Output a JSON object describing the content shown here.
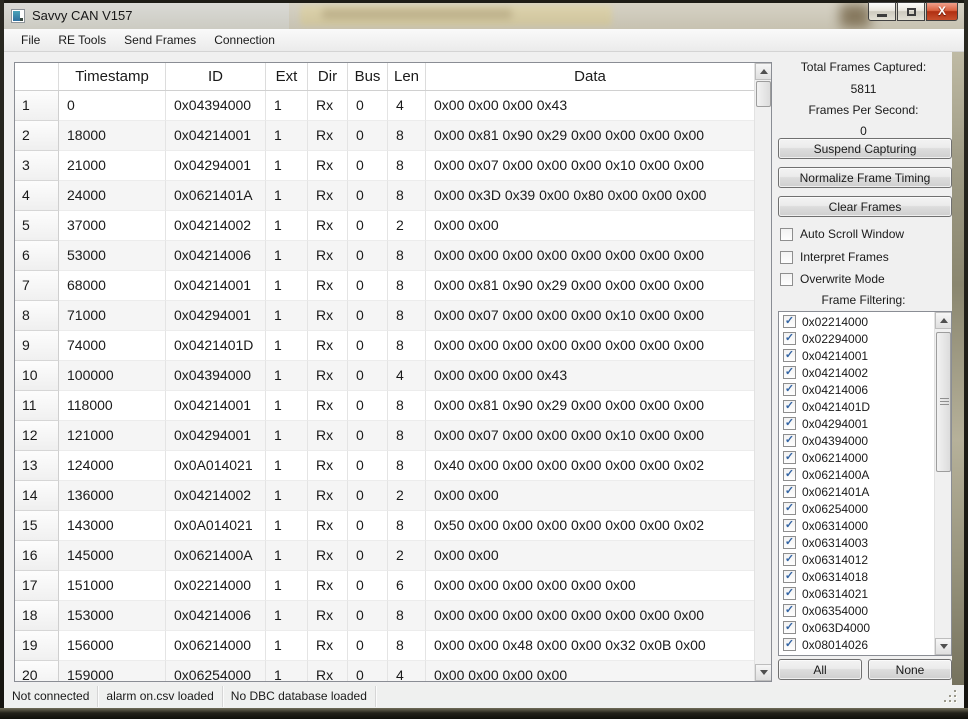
{
  "window": {
    "title": "Savvy CAN V157"
  },
  "menu": {
    "items": [
      "File",
      "RE Tools",
      "Send Frames",
      "Connection"
    ]
  },
  "table": {
    "headers": [
      "Timestamp",
      "ID",
      "Ext",
      "Dir",
      "Bus",
      "Len",
      "Data"
    ],
    "rows": [
      [
        "1",
        "0",
        "0x04394000",
        "1",
        "Rx",
        "0",
        "4",
        "0x00 0x00 0x00 0x43"
      ],
      [
        "2",
        "18000",
        "0x04214001",
        "1",
        "Rx",
        "0",
        "8",
        "0x00 0x81 0x90 0x29 0x00 0x00 0x00 0x00"
      ],
      [
        "3",
        "21000",
        "0x04294001",
        "1",
        "Rx",
        "0",
        "8",
        "0x00 0x07 0x00 0x00 0x00 0x10 0x00 0x00"
      ],
      [
        "4",
        "24000",
        "0x0621401A",
        "1",
        "Rx",
        "0",
        "8",
        "0x00 0x3D 0x39 0x00 0x80 0x00 0x00 0x00"
      ],
      [
        "5",
        "37000",
        "0x04214002",
        "1",
        "Rx",
        "0",
        "2",
        "0x00 0x00"
      ],
      [
        "6",
        "53000",
        "0x04214006",
        "1",
        "Rx",
        "0",
        "8",
        "0x00 0x00 0x00 0x00 0x00 0x00 0x00 0x00"
      ],
      [
        "7",
        "68000",
        "0x04214001",
        "1",
        "Rx",
        "0",
        "8",
        "0x00 0x81 0x90 0x29 0x00 0x00 0x00 0x00"
      ],
      [
        "8",
        "71000",
        "0x04294001",
        "1",
        "Rx",
        "0",
        "8",
        "0x00 0x07 0x00 0x00 0x00 0x10 0x00 0x00"
      ],
      [
        "9",
        "74000",
        "0x0421401D",
        "1",
        "Rx",
        "0",
        "8",
        "0x00 0x00 0x00 0x00 0x00 0x00 0x00 0x00"
      ],
      [
        "10",
        "100000",
        "0x04394000",
        "1",
        "Rx",
        "0",
        "4",
        "0x00 0x00 0x00 0x43"
      ],
      [
        "11",
        "118000",
        "0x04214001",
        "1",
        "Rx",
        "0",
        "8",
        "0x00 0x81 0x90 0x29 0x00 0x00 0x00 0x00"
      ],
      [
        "12",
        "121000",
        "0x04294001",
        "1",
        "Rx",
        "0",
        "8",
        "0x00 0x07 0x00 0x00 0x00 0x10 0x00 0x00"
      ],
      [
        "13",
        "124000",
        "0x0A014021",
        "1",
        "Rx",
        "0",
        "8",
        "0x40 0x00 0x00 0x00 0x00 0x00 0x00 0x02"
      ],
      [
        "14",
        "136000",
        "0x04214002",
        "1",
        "Rx",
        "0",
        "2",
        "0x00 0x00"
      ],
      [
        "15",
        "143000",
        "0x0A014021",
        "1",
        "Rx",
        "0",
        "8",
        "0x50 0x00 0x00 0x00 0x00 0x00 0x00 0x02"
      ],
      [
        "16",
        "145000",
        "0x0621400A",
        "1",
        "Rx",
        "0",
        "2",
        "0x00 0x00"
      ],
      [
        "17",
        "151000",
        "0x02214000",
        "1",
        "Rx",
        "0",
        "6",
        "0x00 0x00 0x00 0x00 0x00 0x00"
      ],
      [
        "18",
        "153000",
        "0x04214006",
        "1",
        "Rx",
        "0",
        "8",
        "0x00 0x00 0x00 0x00 0x00 0x00 0x00 0x00"
      ],
      [
        "19",
        "156000",
        "0x06214000",
        "1",
        "Rx",
        "0",
        "8",
        "0x00 0x00 0x48 0x00 0x00 0x32 0x0B 0x00"
      ],
      [
        "20",
        "159000",
        "0x06254000",
        "1",
        "Rx",
        "0",
        "4",
        "0x00 0x00 0x00 0x00"
      ]
    ]
  },
  "sidebar": {
    "total_frames_label": "Total Frames Captured:",
    "total_frames_value": "5811",
    "fps_label": "Frames Per Second:",
    "fps_value": "0",
    "buttons": {
      "suspend": "Suspend Capturing",
      "normalize": "Normalize Frame Timing",
      "clear": "Clear Frames",
      "all": "All",
      "none": "None"
    },
    "checkboxes": [
      {
        "label": "Auto Scroll Window",
        "checked": false
      },
      {
        "label": "Interpret Frames",
        "checked": false
      },
      {
        "label": "Overwrite Mode",
        "checked": false
      }
    ],
    "filtering_label": "Frame Filtering:",
    "filters": [
      {
        "id": "0x02214000",
        "checked": true
      },
      {
        "id": "0x02294000",
        "checked": true
      },
      {
        "id": "0x04214001",
        "checked": true
      },
      {
        "id": "0x04214002",
        "checked": true
      },
      {
        "id": "0x04214006",
        "checked": true
      },
      {
        "id": "0x0421401D",
        "checked": true
      },
      {
        "id": "0x04294001",
        "checked": true
      },
      {
        "id": "0x04394000",
        "checked": true
      },
      {
        "id": "0x06214000",
        "checked": true
      },
      {
        "id": "0x0621400A",
        "checked": true
      },
      {
        "id": "0x0621401A",
        "checked": true
      },
      {
        "id": "0x06254000",
        "checked": true
      },
      {
        "id": "0x06314000",
        "checked": true
      },
      {
        "id": "0x06314003",
        "checked": true
      },
      {
        "id": "0x06314012",
        "checked": true
      },
      {
        "id": "0x06314018",
        "checked": true
      },
      {
        "id": "0x06314021",
        "checked": true
      },
      {
        "id": "0x06354000",
        "checked": true
      },
      {
        "id": "0x063D4000",
        "checked": true
      },
      {
        "id": "0x08014026",
        "checked": true
      }
    ]
  },
  "status_bar": {
    "panels": [
      "Not connected",
      "alarm on.csv loaded",
      "No DBC database loaded"
    ]
  }
}
